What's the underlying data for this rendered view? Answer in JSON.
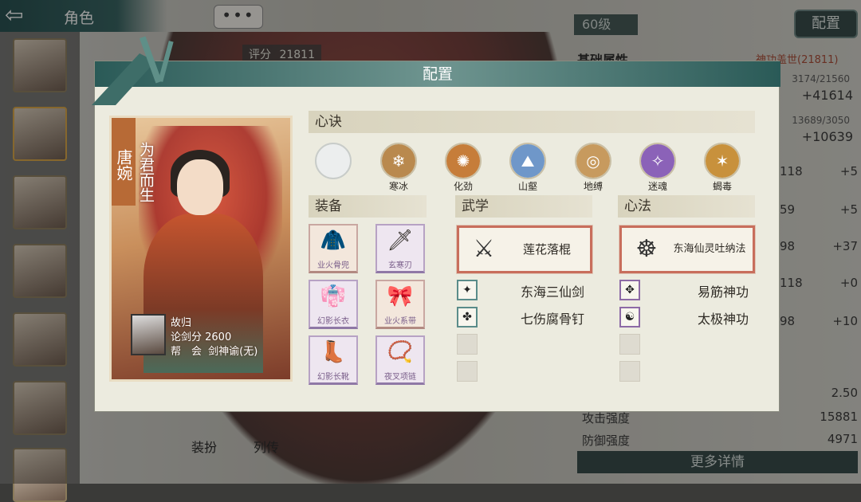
{
  "topbar": {
    "back_icon": "back-arrow-icon",
    "title": "角色",
    "chat_label": "•••"
  },
  "score": {
    "label": "评分",
    "value": "21811"
  },
  "level": "60级",
  "config_button": "配置",
  "attributes": {
    "title": "基础属性",
    "rank": "神功盖世(21811)",
    "stats": [
      {
        "small": "3174/21560",
        "big": "+41614"
      },
      {
        "small": "13689/3050",
        "big": "+10639"
      }
    ],
    "rows": [
      {
        "left": "118",
        "right": "+5"
      },
      {
        "left": "59",
        "right": "+5"
      },
      {
        "left": "98",
        "right": "+37"
      },
      {
        "left": "118",
        "right": "+0"
      },
      {
        "left": "98",
        "right": "+10"
      }
    ],
    "extra": [
      {
        "label": "",
        "value": "2.50"
      },
      {
        "label": "攻击强度",
        "value": "15881"
      },
      {
        "label": "防御强度",
        "value": "4971"
      }
    ],
    "more": "更多详情"
  },
  "bottom_tabs": [
    {
      "label": "装扮"
    },
    {
      "label": "列传"
    }
  ],
  "modal": {
    "title": "配置",
    "character": {
      "name": "唐婉",
      "title": "为君而生"
    },
    "player": {
      "name": "故归",
      "score": "论剑分 2600",
      "guild_label": "帮　会",
      "guild": "剑神谕(无)"
    },
    "xinjue": {
      "header": "心诀",
      "items": [
        {
          "label": "",
          "icon": "empty-slot",
          "color": ""
        },
        {
          "label": "寒冰",
          "icon": "snowflake-icon",
          "color": "#b9894e",
          "glyph": "❄"
        },
        {
          "label": "化劲",
          "icon": "swirl-icon",
          "color": "#c67d3a",
          "glyph": "✺"
        },
        {
          "label": "山壑",
          "icon": "mountain-icon",
          "color": "#6f97c9",
          "glyph": "⛰"
        },
        {
          "label": "地缚",
          "icon": "bind-icon",
          "color": "#c79a5e",
          "glyph": "◎"
        },
        {
          "label": "迷魂",
          "icon": "spirit-icon",
          "color": "#8b62b8",
          "glyph": "✧"
        },
        {
          "label": "蝎毒",
          "icon": "scorpion-icon",
          "color": "#c8913c",
          "glyph": "✶"
        }
      ]
    },
    "equipment": {
      "header": "装备",
      "items": [
        {
          "label": "业火骨兜",
          "icon": "hood-icon",
          "glyph": "🧥"
        },
        {
          "label": "玄寒刃",
          "icon": "blade-icon",
          "glyph": "🗡"
        },
        {
          "label": "幻影长衣",
          "icon": "robe-icon",
          "glyph": "👘"
        },
        {
          "label": "业火系带",
          "icon": "belt-icon",
          "glyph": "🎀"
        },
        {
          "label": "幻影长靴",
          "icon": "boots-icon",
          "glyph": "👢"
        },
        {
          "label": "夜叉项链",
          "icon": "necklace-icon",
          "glyph": "📿"
        }
      ]
    },
    "wuxue": {
      "header": "武学",
      "main": {
        "label": "莲花落棍",
        "icon": "staff-fighter-icon",
        "glyph": "⚔"
      },
      "subs": [
        {
          "label": "东海三仙剑",
          "icon": "sword-fighter-icon",
          "glyph": "✦"
        },
        {
          "label": "七伤腐骨钉",
          "icon": "nail-fighter-icon",
          "glyph": "✤"
        }
      ]
    },
    "xinfa": {
      "header": "心法",
      "main": {
        "label": "东海仙灵吐纳法",
        "icon": "meditation-icon",
        "glyph": "☸"
      },
      "subs": [
        {
          "label": "易筋神功",
          "icon": "tendon-icon",
          "glyph": "✥"
        },
        {
          "label": "太极神功",
          "icon": "taiji-icon",
          "glyph": "☯"
        }
      ]
    }
  }
}
